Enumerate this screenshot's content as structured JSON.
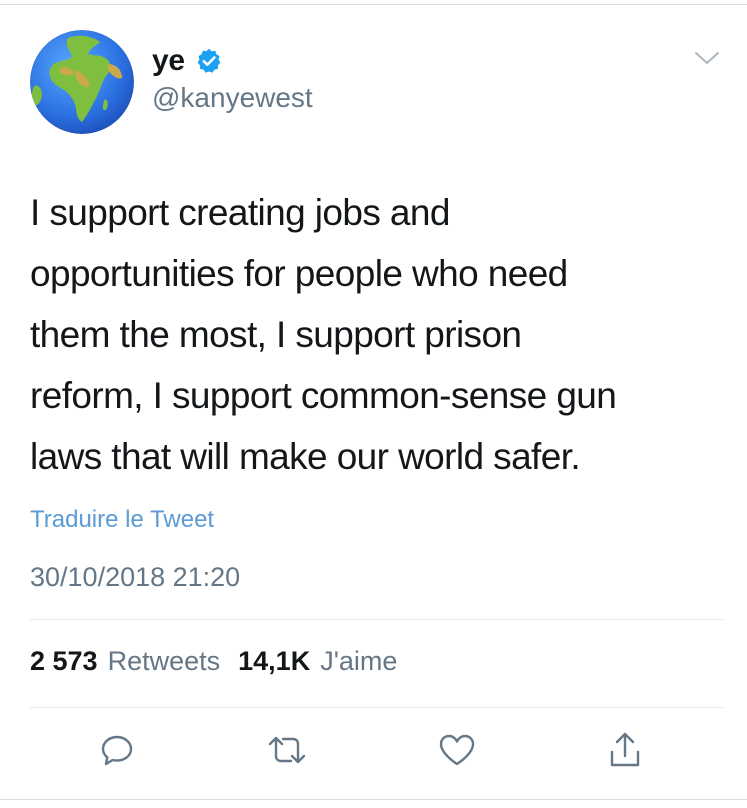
{
  "user": {
    "display_name": "ye",
    "handle": "@kanyewest",
    "verified": true,
    "avatar": "earth-globe-africa-icon"
  },
  "tweet": {
    "text": "I support creating jobs and\nopportunities for people who need\nthem the most, I support prison\nreform, I support common-sense gun\nlaws that will make our world safer.",
    "translate_label": "Traduire le Tweet",
    "timestamp": "30/10/2018 21:20"
  },
  "stats": {
    "retweets_count": "2 573",
    "retweets_label": "Retweets",
    "likes_count": "14,1K",
    "likes_label": "J'aime"
  },
  "actions": [
    {
      "name": "reply",
      "icon": "reply-icon"
    },
    {
      "name": "retweet",
      "icon": "retweet-icon"
    },
    {
      "name": "like",
      "icon": "heart-icon"
    },
    {
      "name": "share",
      "icon": "share-icon"
    }
  ],
  "colors": {
    "link": "#5b9bd5",
    "verified": "#1da1f2",
    "secondary_text": "#657786",
    "primary_text": "#14171a"
  }
}
